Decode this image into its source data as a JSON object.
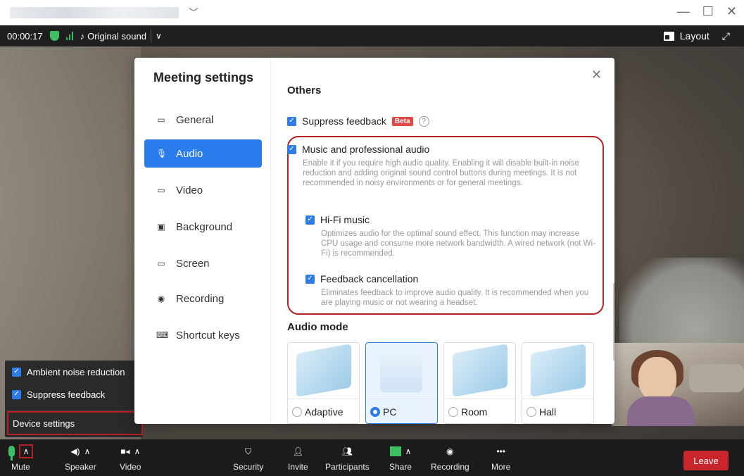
{
  "window": {
    "controls": [
      "—",
      "☐",
      "✕"
    ]
  },
  "meeting_bar": {
    "timer": "00:00:17",
    "original_sound": "Original sound",
    "layout_label": "Layout"
  },
  "popup": {
    "ambient_noise": "Ambient noise reduction",
    "suppress_feedback": "Suppress feedback",
    "device_settings": "Device settings"
  },
  "toolbar": {
    "mute": "Mute",
    "speaker": "Speaker",
    "video": "Video",
    "security": "Security",
    "invite": "Invite",
    "participants": "Participants",
    "share": "Share",
    "recording": "Recording",
    "more": "More",
    "leave": "Leave"
  },
  "dialog": {
    "title": "Meeting settings",
    "nav": [
      {
        "label": "General",
        "icon": "general-icon"
      },
      {
        "label": "Audio",
        "icon": "mic-icon",
        "active": true
      },
      {
        "label": "Video",
        "icon": "camera-icon"
      },
      {
        "label": "Background",
        "icon": "background-icon"
      },
      {
        "label": "Screen",
        "icon": "screen-icon"
      },
      {
        "label": "Recording",
        "icon": "record-icon"
      },
      {
        "label": "Shortcut keys",
        "icon": "keyboard-icon"
      }
    ],
    "others_title": "Others",
    "suppress_feedback": "Suppress feedback",
    "beta": "Beta",
    "music_pro": "Music and professional audio",
    "music_pro_desc": "Enable it if you require high audio quality. Enabling it will disable built-in noise reduction and adding original sound control buttons during meetings. It is not recommended in noisy environments or for general meetings.",
    "hifi": "Hi-Fi music",
    "hifi_desc": "Optimizes audio for the optimal sound effect. This function may increase CPU usage and consume more network bandwidth. A wired network (not Wi-Fi) is recommended.",
    "feedback_cancel": "Feedback cancellation",
    "feedback_cancel_desc": "Eliminates feedback to improve audio quality. It is recommended when you are playing music or not wearing a headset.",
    "audio_mode_title": "Audio mode",
    "modes": [
      "Adaptive",
      "PC",
      "Room",
      "Hall"
    ],
    "selected_mode": "PC"
  },
  "colors": {
    "accent": "#2a7bec",
    "highlight_red": "#b81f24",
    "leave_red": "#c8262c",
    "status_green": "#3fbf63"
  }
}
